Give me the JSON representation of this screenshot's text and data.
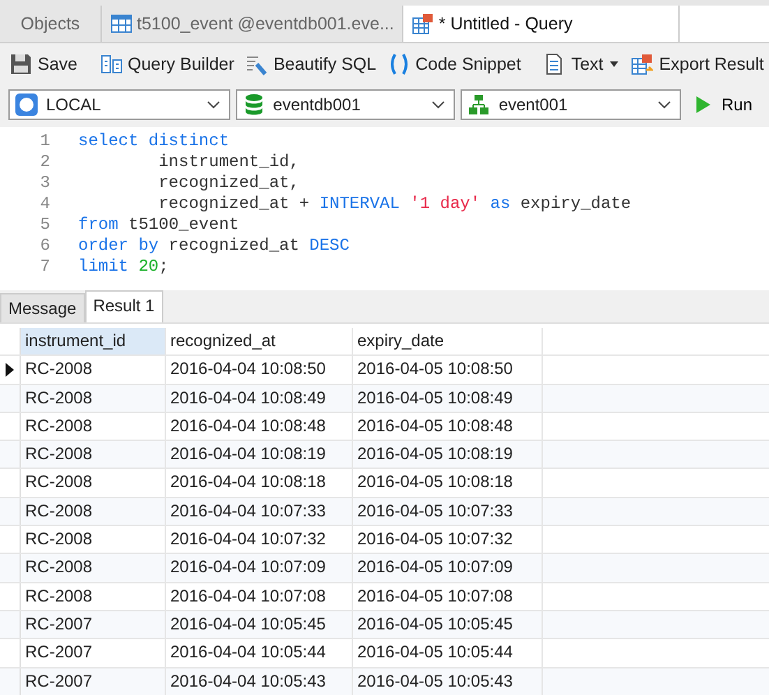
{
  "tabs": [
    {
      "label": "Objects",
      "kind": "plain",
      "selected": false
    },
    {
      "label": "t5100_event @eventdb001.eve...",
      "kind": "table",
      "selected": false
    },
    {
      "label": "* Untitled - Query",
      "kind": "query",
      "selected": true
    }
  ],
  "toolbar": [
    {
      "label": "Save",
      "kind": "save"
    },
    {
      "label": "Query Builder",
      "kind": "builder"
    },
    {
      "label": "Beautify SQL",
      "kind": "beautify"
    },
    {
      "label": "Code Snippet",
      "kind": "snippet"
    },
    {
      "label": "Text",
      "kind": "text"
    },
    {
      "label": "Export Result",
      "kind": "export"
    }
  ],
  "selectors": [
    {
      "value": "LOCAL",
      "kind": "connection"
    },
    {
      "value": "eventdb001",
      "kind": "database"
    },
    {
      "value": "event001",
      "kind": "schema"
    }
  ],
  "run_button": "Run",
  "editor": {
    "lines": [
      {
        "number": "1",
        "tokens": [
          {
            "text": "select distinct",
            "kind": "keyword"
          }
        ]
      },
      {
        "number": "2",
        "tokens": [
          {
            "text": "        instrument_id,",
            "kind": "plain"
          }
        ]
      },
      {
        "number": "3",
        "tokens": [
          {
            "text": "        recognized_at,",
            "kind": "plain"
          }
        ]
      },
      {
        "number": "4",
        "tokens": [
          {
            "text": "        recognized_at + ",
            "kind": "plain"
          },
          {
            "text": "INTERVAL ",
            "kind": "keyword"
          },
          {
            "text": "'1 day' ",
            "kind": "string"
          },
          {
            "text": "as",
            "kind": "keyword"
          },
          {
            "text": " expiry_date",
            "kind": "plain"
          }
        ]
      },
      {
        "number": "5",
        "tokens": [
          {
            "text": "from",
            "kind": "keyword"
          },
          {
            "text": " t5100_event",
            "kind": "plain"
          }
        ]
      },
      {
        "number": "6",
        "tokens": [
          {
            "text": "order by",
            "kind": "keyword"
          },
          {
            "text": " recognized_at ",
            "kind": "plain"
          },
          {
            "text": "DESC",
            "kind": "keyword"
          }
        ]
      },
      {
        "number": "7",
        "tokens": [
          {
            "text": "limit ",
            "kind": "keyword"
          },
          {
            "text": "20",
            "kind": "number"
          },
          {
            "text": ";",
            "kind": "plain"
          }
        ]
      }
    ]
  },
  "result_tabs": [
    {
      "label": "Message",
      "selected": false
    },
    {
      "label": "Result 1",
      "selected": true
    }
  ],
  "table": {
    "columns": [
      {
        "label": "instrument_id",
        "selected": true
      },
      {
        "label": "recognized_at",
        "selected": false
      },
      {
        "label": "expiry_date",
        "selected": false
      }
    ],
    "rows": [
      {
        "selected": true,
        "cells": [
          "RC-2008",
          "2016-04-04 10:08:50",
          "2016-04-05 10:08:50"
        ]
      },
      {
        "selected": false,
        "cells": [
          "RC-2008",
          "2016-04-04 10:08:49",
          "2016-04-05 10:08:49"
        ]
      },
      {
        "selected": false,
        "cells": [
          "RC-2008",
          "2016-04-04 10:08:48",
          "2016-04-05 10:08:48"
        ]
      },
      {
        "selected": false,
        "cells": [
          "RC-2008",
          "2016-04-04 10:08:19",
          "2016-04-05 10:08:19"
        ]
      },
      {
        "selected": false,
        "cells": [
          "RC-2008",
          "2016-04-04 10:08:18",
          "2016-04-05 10:08:18"
        ]
      },
      {
        "selected": false,
        "cells": [
          "RC-2008",
          "2016-04-04 10:07:33",
          "2016-04-05 10:07:33"
        ]
      },
      {
        "selected": false,
        "cells": [
          "RC-2008",
          "2016-04-04 10:07:32",
          "2016-04-05 10:07:32"
        ]
      },
      {
        "selected": false,
        "cells": [
          "RC-2008",
          "2016-04-04 10:07:09",
          "2016-04-05 10:07:09"
        ]
      },
      {
        "selected": false,
        "cells": [
          "RC-2008",
          "2016-04-04 10:07:08",
          "2016-04-05 10:07:08"
        ]
      },
      {
        "selected": false,
        "cells": [
          "RC-2007",
          "2016-04-04 10:05:45",
          "2016-04-05 10:05:45"
        ]
      },
      {
        "selected": false,
        "cells": [
          "RC-2007",
          "2016-04-04 10:05:44",
          "2016-04-05 10:05:44"
        ]
      },
      {
        "selected": false,
        "cells": [
          "RC-2007",
          "2016-04-04 10:05:43",
          "2016-04-05 10:05:43"
        ]
      }
    ]
  }
}
